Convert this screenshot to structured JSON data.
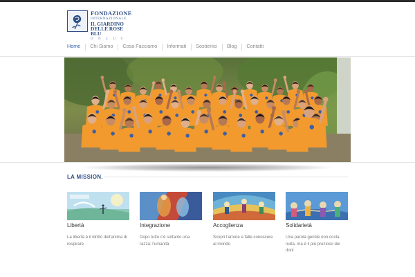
{
  "site": {
    "logo": {
      "line1": "FONDAZIONE",
      "line2": "INTERNAZIONALE",
      "line3": "IL GIARDINO",
      "line4": "DELLE ROSE BLU",
      "line5": "O N L U S"
    }
  },
  "nav": {
    "items": [
      {
        "label": "Home",
        "active": true
      },
      {
        "label": "Chi Siamo",
        "active": false
      },
      {
        "label": "Cosa Facciamo",
        "active": false
      },
      {
        "label": "Informati",
        "active": false
      },
      {
        "label": "Sostienici",
        "active": false
      },
      {
        "label": "Blog",
        "active": false
      },
      {
        "label": "Contatti",
        "active": false
      }
    ]
  },
  "mission": {
    "title": "LA MISSION.",
    "cards": [
      {
        "title": "Libertà",
        "text": "La libertà è il diritto dell'anima di respirare"
      },
      {
        "title": "Integrazione",
        "text": "Dopo tutto c'è soltanto una razza: l'umanità"
      },
      {
        "title": "Accoglienza",
        "text": "Scopri l'amore e falle conoscere al mondo"
      },
      {
        "title": "Solidarietà",
        "text": "Una parola gentile non costa nulla, ma è il più prezioso dei doni"
      }
    ]
  },
  "colors": {
    "brand": "#2f4f86",
    "nav_active": "#2f5ea8",
    "shirt_orange": "#f29a2e"
  }
}
